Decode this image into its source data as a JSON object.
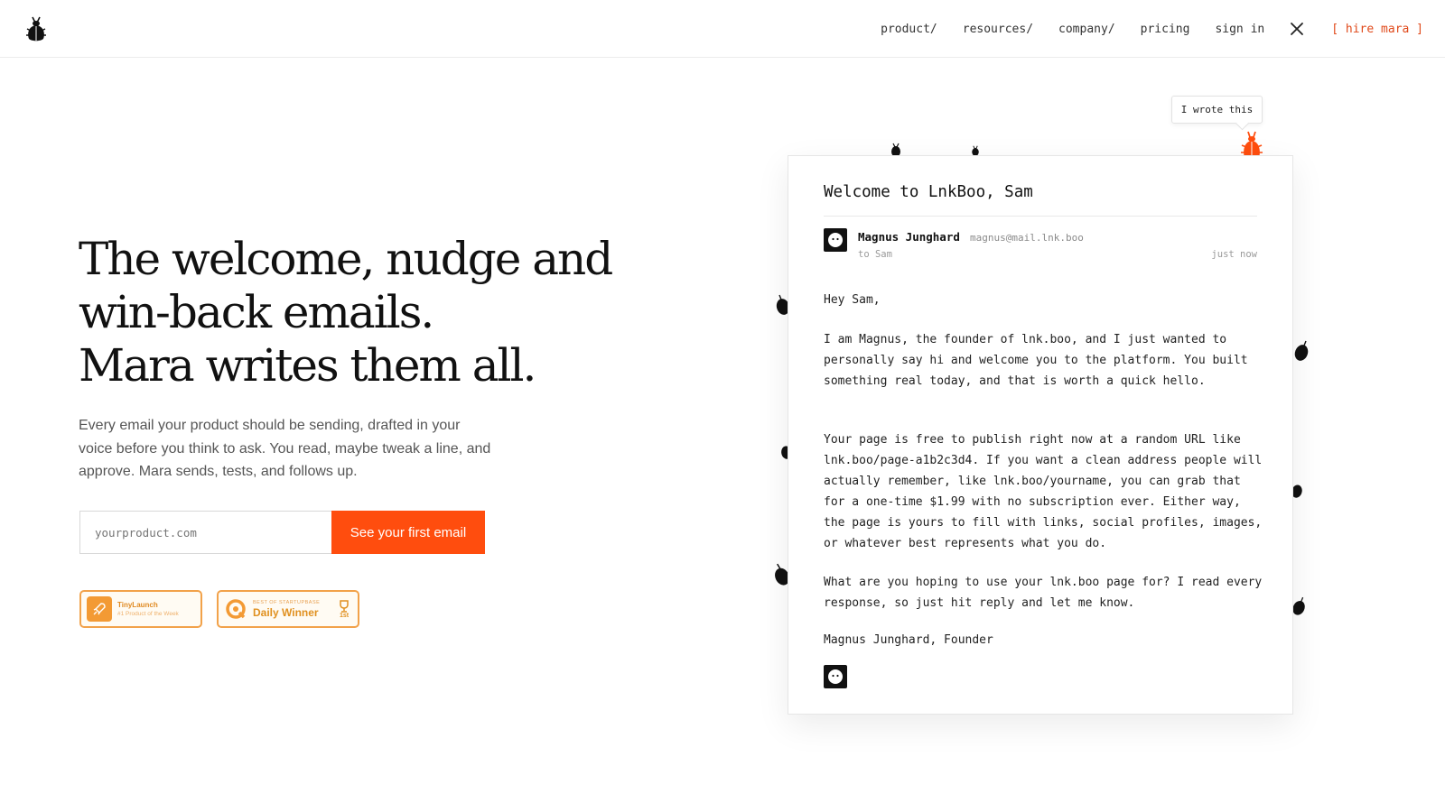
{
  "nav": {
    "logo_icon": "beetle-logo-icon",
    "links": [
      "product/",
      "resources/",
      "company/",
      "pricing",
      "sign in"
    ],
    "x_icon": "x-twitter-icon",
    "hire": "[ hire mara ]"
  },
  "hero": {
    "title_lines": [
      "The welcome, nudge and",
      "win-back emails.",
      "Mara writes them all."
    ],
    "subtitle": "Every email your product should be sending, drafted in your voice before you think to ask. You read, maybe tweak a line, and approve. Mara sends, tests, and follows up.",
    "input_placeholder": "yourproduct.com",
    "cta_label": "See your first email"
  },
  "badges": {
    "tinylaunch": {
      "name": "TinyLaunch",
      "sub": "#1 Product of the Week"
    },
    "startupbase": {
      "sub": "BEST OF STARTUPBASE",
      "name": "Daily Winner",
      "rank": "1st"
    }
  },
  "email": {
    "subject": "Welcome to LnkBoo, Sam",
    "sender_name": "Magnus Junghard",
    "sender_email": "magnus@mail.lnk.boo",
    "to": "to Sam",
    "time": "just now",
    "paragraphs": [
      "Hey Sam,",
      "I am Magnus, the founder of lnk.boo, and I just wanted to personally say hi and welcome you to the platform. You built something real today, and that is worth a quick hello.",
      "Your page is free to publish right now at a random URL like lnk.boo/page-a1b2c3d4. If you want a clean address people will actually remember, like lnk.boo/yourname, you can grab that for a one-time $1.99 with no subscription ever. Either way, the page is yours to fill with links, social profiles, images, or whatever best represents what you do.",
      "What are you hoping to use your lnk.boo page for? I read every response, so just hit reply and let me know.",
      "Magnus Junghard, Founder"
    ]
  },
  "tooltip": "I wrote this",
  "colors": {
    "accent": "#ff4d0e",
    "badge": "#f39a34",
    "ink": "#111111"
  }
}
